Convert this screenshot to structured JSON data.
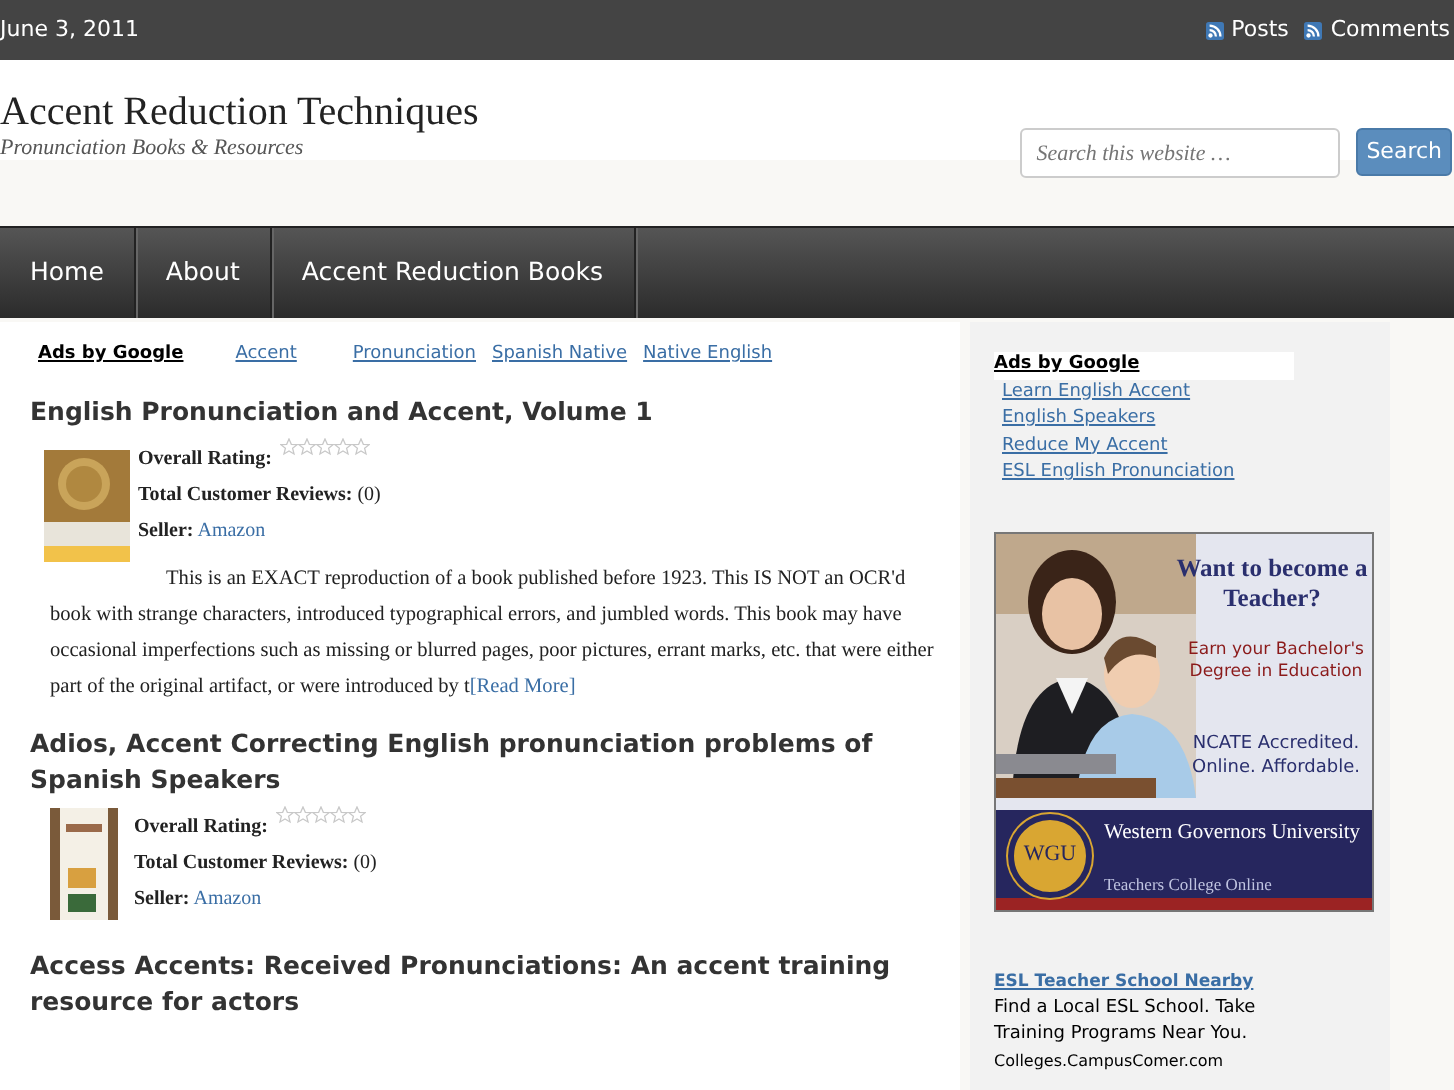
{
  "top_bar": {
    "date": "June 3, 2011",
    "links": [
      "Posts",
      "Comments"
    ]
  },
  "header": {
    "title": "Accent Reduction Techniques",
    "tagline": "Pronunciation Books & Resources",
    "search": {
      "placeholder": "Search this website …",
      "button": "Search"
    }
  },
  "nav": {
    "items": [
      {
        "label": "Home"
      },
      {
        "label": "About"
      },
      {
        "label": "Accent Reduction Books"
      }
    ]
  },
  "ad_links": {
    "label": "Ads by Google",
    "links": [
      "Accent",
      "Pronunciation",
      "Spanish Native",
      "Native English"
    ]
  },
  "books": [
    {
      "title": "English Pronunciation and Accent, Volume 1",
      "rating_label": "Overall Rating:",
      "stars": 0,
      "reviews_label": "Total Customer Reviews:",
      "reviews": "(0)",
      "seller_label": "Seller:",
      "seller": "Amazon",
      "description": "This is an EXACT reproduction of a book published before 1923. This IS NOT an OCR'd book with strange characters, introduced typographical errors, and jumbled words. This book may have occasional imperfections such as missing or blurred pages, poor pictures, errant marks, etc. that were either part of the original artifact, or were introduced by t",
      "read_more": "[Read More]"
    },
    {
      "title": "Adios, Accent Correcting English pronunciation problems of Spanish Speakers",
      "rating_label": "Overall Rating:",
      "stars": 0,
      "reviews_label": "Total Customer Reviews:",
      "reviews": "(0)",
      "seller_label": "Seller:",
      "seller": "Amazon"
    },
    {
      "title": "Access Accents: Received Pronunciations: An accent training resource for actors"
    }
  ],
  "sidebar": {
    "ads_label": "Ads by Google",
    "ad_links": [
      "Learn English Accent",
      "English Speakers",
      "Reduce My Accent",
      "ESL English Pronunciation"
    ],
    "banner": {
      "headline": "Want to become a Teacher?",
      "offer": "Earn your Bachelor's Degree in Education",
      "claim": "NCATE Accredited. Online. Affordable.",
      "logo": "WGU",
      "org": "Western Governors University",
      "college": "Teachers College Online"
    },
    "text_ad": {
      "title": "ESL Teacher School Nearby",
      "body": "Find a Local ESL School. Take Training Programs Near You.",
      "url": "Colleges.CampusComer.com"
    }
  }
}
